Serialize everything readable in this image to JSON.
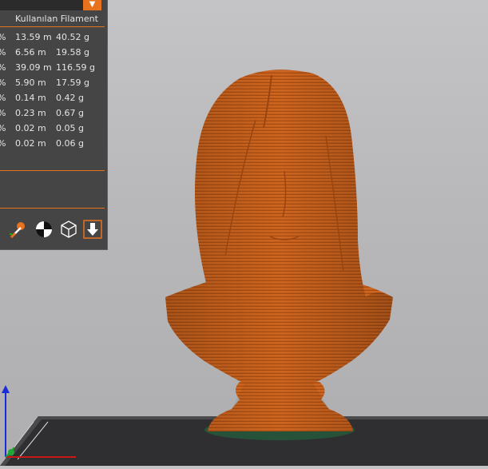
{
  "panel": {
    "header": "Kullanılan Filament",
    "rows": [
      {
        "pct": "%",
        "len": "13.59 m",
        "wgt": "40.52 g"
      },
      {
        "pct": "%",
        "len": "6.56 m",
        "wgt": "19.58 g"
      },
      {
        "pct": "%",
        "len": "39.09 m",
        "wgt": "116.59 g"
      },
      {
        "pct": "%",
        "len": "5.90 m",
        "wgt": "17.59 g"
      },
      {
        "pct": "%",
        "len": "0.14 m",
        "wgt": "0.42 g"
      },
      {
        "pct": "%",
        "len": "0.23 m",
        "wgt": "0.67 g"
      },
      {
        "pct": "%",
        "len": "0.02 m",
        "wgt": "0.05 g"
      },
      {
        "pct": "%",
        "len": "0.02 m",
        "wgt": "0.06 g"
      }
    ],
    "dropdown_glyph": "▼"
  },
  "toolbar": {
    "icons": [
      "paint-tool-icon",
      "seam-painting-icon",
      "cube-view-icon",
      "export-icon"
    ]
  },
  "colors": {
    "accent": "#e8731e",
    "model": "#c8601e",
    "panel_bg": "#454545"
  }
}
